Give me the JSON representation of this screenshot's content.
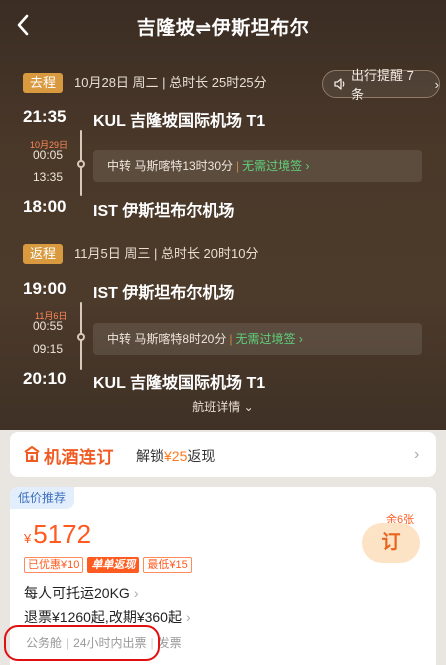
{
  "nav": {
    "title": "吉隆坡⇌伊斯坦布尔"
  },
  "outbound": {
    "tag": "去程",
    "meta": "10月28日 周二 | 总时长 25时25分",
    "reminder": "出行提醒 7条",
    "depart_time": "21:35",
    "depart_airport": "KUL 吉隆坡国际机场 T1",
    "stop_date": "10月29日",
    "stop_arrive": "00:05",
    "stop_depart": "13:35",
    "transfer": "中转 马斯喀特13时30分",
    "transfer_note": "无需过境签",
    "arrive_time": "18:00",
    "arrive_airport": "IST 伊斯坦布尔机场"
  },
  "inbound": {
    "tag": "返程",
    "meta": "11月5日 周三 | 总时长 20时10分",
    "depart_time": "19:00",
    "depart_airport": "IST 伊斯坦布尔机场",
    "stop_date": "11月6日",
    "stop_arrive": "00:55",
    "stop_depart": "09:15",
    "transfer": "中转 马斯喀特8时20分",
    "transfer_note": "无需过境签",
    "arrive_time": "20:10",
    "arrive_airport": "KUL 吉隆坡国际机场 T1"
  },
  "flight_details": "航班详情",
  "bundle": {
    "brand": "机酒连订",
    "unlock_prefix": "解锁",
    "unlock_amount": "¥25",
    "unlock_suffix": "返现"
  },
  "offer": {
    "tag": "低价推荐",
    "currency": "¥",
    "price": "5172",
    "remaining": "余6张",
    "book_label": "订",
    "discount": "已优惠¥10",
    "promo_badge": "单单返现",
    "promo_min": "最低¥15",
    "baggage": "每人可托运20KG",
    "refund": "退票¥1260起,改期¥360起",
    "cabin": "公务舱",
    "ticketing": "24小时内出票",
    "invoice": "发票"
  },
  "colors": {
    "accent": "#ff5a1f",
    "tag_gold": "#d99a3f",
    "visa_green": "#5fd07a",
    "highlight_box": "#e01010"
  }
}
